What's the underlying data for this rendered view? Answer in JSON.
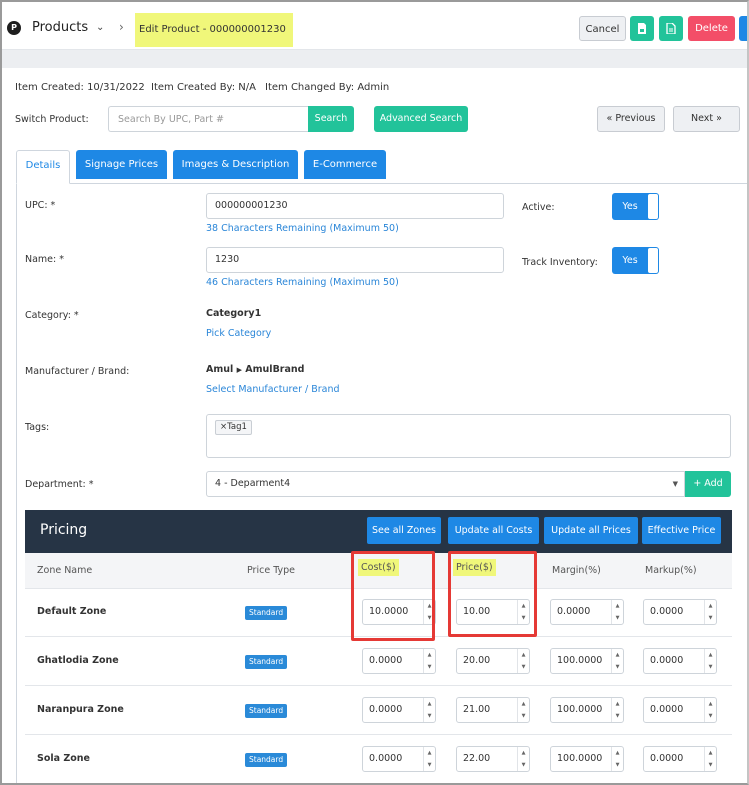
{
  "header": {
    "logo_glyph": "P",
    "title": "Products",
    "chevron_down": "❯",
    "breadcrumb": "Edit Product - 000000001230",
    "buttons": {
      "cancel": "Cancel",
      "delete": "Delete"
    }
  },
  "meta": {
    "created": "Item Created: 10/31/2022",
    "created_by": "Item Created By: N/A",
    "changed_by": "Item Changed By: Admin"
  },
  "switch": {
    "label": "Switch Product:",
    "placeholder": "Search By UPC, Part #",
    "search": "Search",
    "advanced": "Advanced Search",
    "previous": "« Previous",
    "next": "Next »"
  },
  "tabs": [
    "Details",
    "Signage Prices",
    "Images & Description",
    "E-Commerce"
  ],
  "form": {
    "upc_label": "UPC: *",
    "upc_value": "000000001230",
    "upc_hint": "38 Characters Remaining (Maximum 50)",
    "active_label": "Active:",
    "active_value": "Yes",
    "name_label": "Name: *",
    "name_value": "1230",
    "name_hint": "46 Characters Remaining (Maximum 50)",
    "track_label": "Track Inventory:",
    "track_value": "Yes",
    "category_label": "Category: *",
    "category_value": "Category1",
    "category_link": "Pick Category",
    "manufacturer_label": "Manufacturer / Brand:",
    "manufacturer_value": "Amul",
    "brand_value": "AmulBrand",
    "manufacturer_link": "Select Manufacturer / Brand",
    "tags_label": "Tags:",
    "tag1": "×Tag1",
    "department_label": "Department: *",
    "department_value": "4 - Deparment4",
    "add_label": "+ Add"
  },
  "pricing": {
    "title": "Pricing",
    "buttons": [
      "See all Zones",
      "Update all Costs",
      "Update all Prices",
      "Effective Price"
    ],
    "columns": [
      "Zone Name",
      "Price Type",
      "Cost($)",
      "Price($)",
      "Margin(%)",
      "Markup(%)"
    ],
    "rows": [
      {
        "zone": "Default Zone",
        "type": "Standard",
        "cost": "10.0000",
        "price": "10.00",
        "margin": "0.0000",
        "markup": "0.0000"
      },
      {
        "zone": "Ghatlodia Zone",
        "type": "Standard",
        "cost": "0.0000",
        "price": "20.00",
        "margin": "100.0000",
        "markup": "0.0000"
      },
      {
        "zone": "Naranpura Zone",
        "type": "Standard",
        "cost": "0.0000",
        "price": "21.00",
        "margin": "100.0000",
        "markup": "0.0000"
      },
      {
        "zone": "Sola Zone",
        "type": "Standard",
        "cost": "0.0000",
        "price": "22.00",
        "margin": "100.0000",
        "markup": "0.0000"
      }
    ]
  },
  "colors": {
    "teal": "#22c39a",
    "blue": "#1e88e5",
    "red": "#f34e68",
    "dark": "#263445",
    "highlight": "#f0f77a",
    "annotation": "#e53935"
  }
}
